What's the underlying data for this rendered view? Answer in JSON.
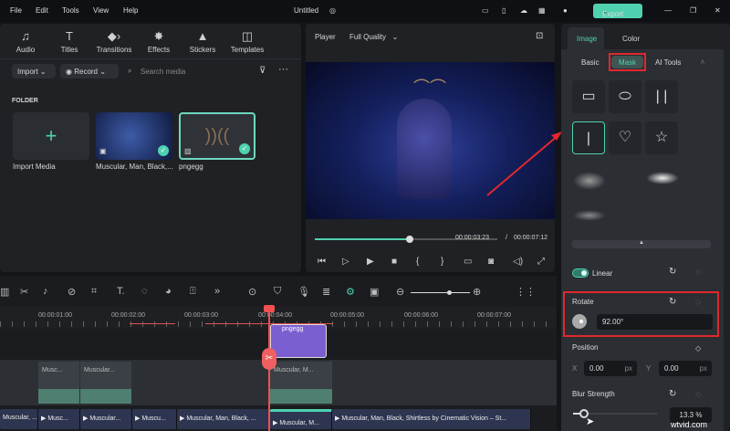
{
  "menu": [
    "File",
    "Edit",
    "Tools",
    "View",
    "Help"
  ],
  "title": "Untitled",
  "export_label": "Export",
  "toolbar": [
    "Audio",
    "Titles",
    "Transitions",
    "Effects",
    "Stickers",
    "Templates"
  ],
  "media": {
    "import": "Import",
    "record": "Record",
    "search_placeholder": "Search media",
    "folder": "FOLDER",
    "items": [
      "Import Media",
      "Muscular, Man, Black,...",
      "pngegg"
    ]
  },
  "player": {
    "label": "Player",
    "quality": "Full Quality",
    "current": "00:00:03:23",
    "separator": "/",
    "total": "00:00:07:12",
    "progress": 0.52
  },
  "ruler": [
    "00:00:01:00",
    "00:00:02:00",
    "00:00:03:00",
    "00:00:04:00",
    "00:00:05:00",
    "00:00:06:00",
    "00:00:07:00"
  ],
  "tracks": {
    "overlay": "pngegg",
    "mid": [
      "Musc...",
      "Muscular...",
      "Muscular, M..."
    ],
    "main": [
      "Muscular, ...",
      "Musc...",
      "Muscular...",
      "Muscu...",
      "Muscular, Man, Black, ...",
      "Muscular, M...",
      "Muscular, Man, Black, Shirtless by Cinematic Vision – St..."
    ]
  },
  "right": {
    "tabs": [
      "Image",
      "Color"
    ],
    "subtabs": [
      "Basic",
      "Mask",
      "AI Tools"
    ],
    "linear": "Linear",
    "rotate": "Rotate",
    "rotate_value": "92.00°",
    "position": "Position",
    "x_label": "X",
    "x_value": "0.00",
    "y_label": "Y",
    "y_value": "0.00",
    "px": "px",
    "blur": "Blur Strength",
    "blur_value": "13.3",
    "percent": "%",
    "blur_fraction": 0.133
  },
  "watermark": "wtvid.com",
  "colors": {
    "accent": "#4fd1b0",
    "highlight": "#e0282e",
    "playhead": "#f05050"
  }
}
